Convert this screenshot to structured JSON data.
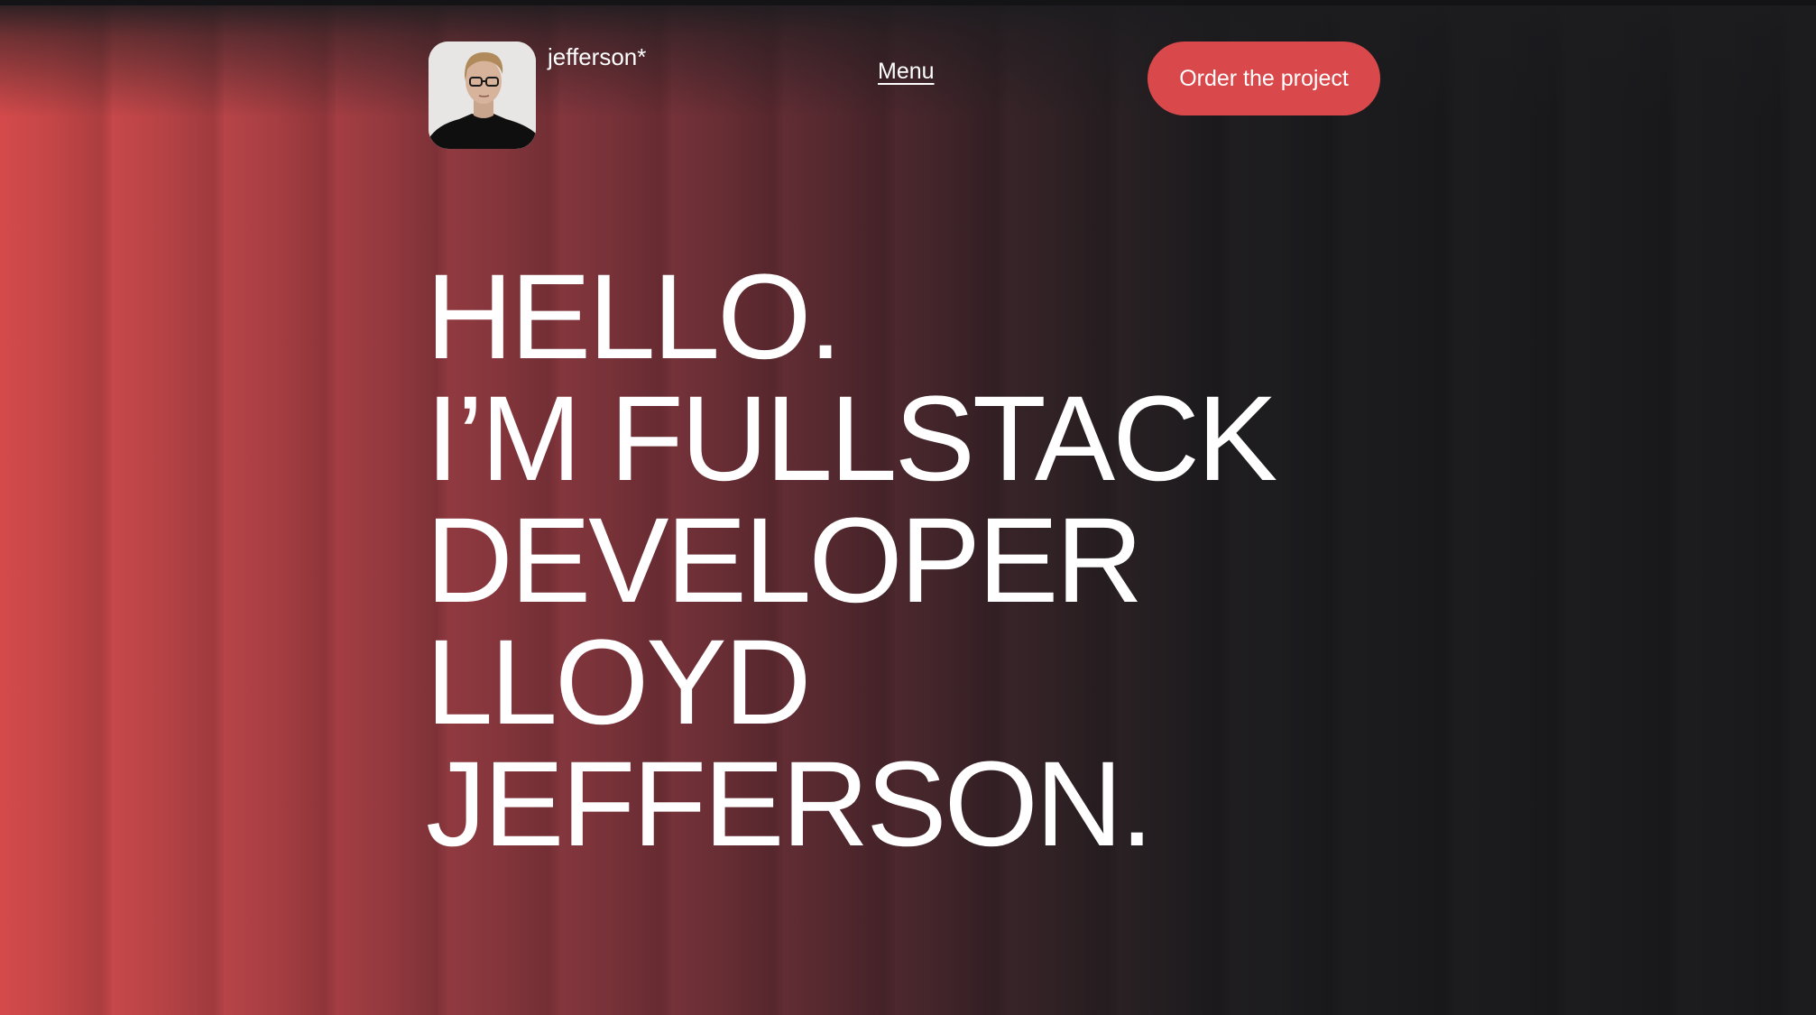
{
  "header": {
    "brand": "jefferson*",
    "menu_label": "Menu",
    "cta_label": "Order the project",
    "avatar_icon": "portrait-photo"
  },
  "hero": {
    "lines": [
      "HELLO.",
      "I’M FULLSTACK",
      "DEVELOPER",
      "LLOYD",
      "JEFFERSON."
    ]
  },
  "colors": {
    "accent": "#d9494c",
    "background": "#1c1c1f",
    "text": "#ffffff"
  }
}
